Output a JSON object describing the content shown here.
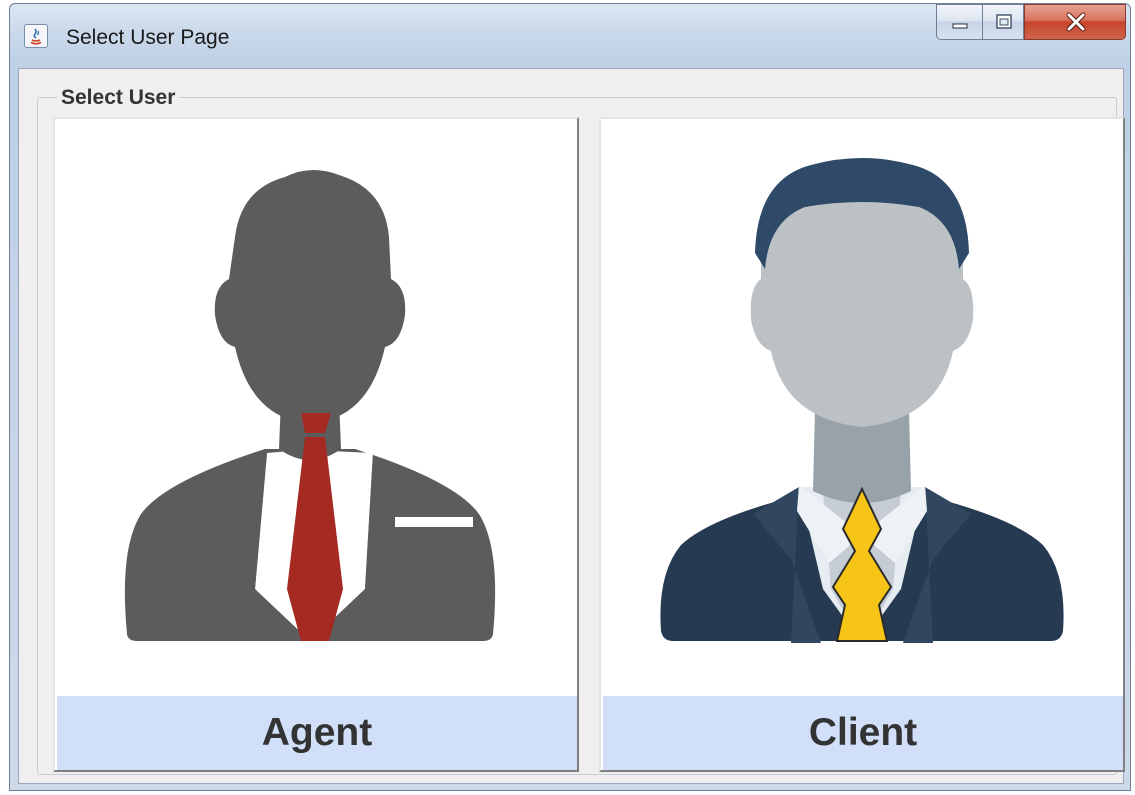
{
  "window": {
    "title": "Select User Page",
    "controls": {
      "minimize": "minimize",
      "maximize": "maximize",
      "close": "close"
    }
  },
  "group": {
    "title": "Select User",
    "options": [
      {
        "label": "Agent",
        "icon": "agent-avatar-icon"
      },
      {
        "label": "Client",
        "icon": "client-avatar-icon"
      }
    ]
  },
  "colors": {
    "agent_silhouette": "#5c5c5c",
    "agent_tie": "#a52a22",
    "client_hair": "#2f4a68",
    "client_face": "#bcc1c6",
    "client_suit": "#263a52",
    "client_tie": "#f7c418",
    "label_band": "#d2dff9"
  }
}
